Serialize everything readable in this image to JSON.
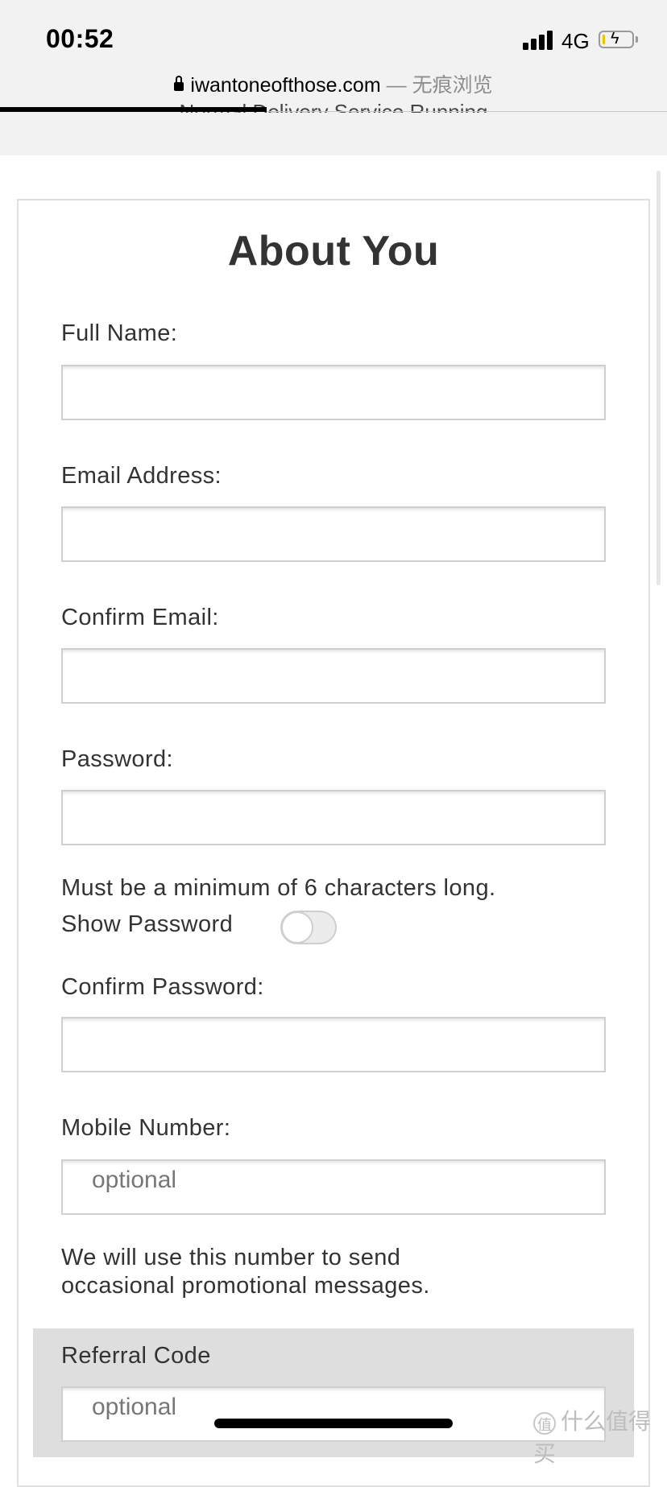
{
  "status_bar": {
    "time": "00:52",
    "network": "4G",
    "battery_level": 0.1,
    "battery_charging": true,
    "signal_bars": 4
  },
  "browser": {
    "domain": "iwantoneofthose.com",
    "mode_suffix": "— 无痕浏览",
    "page_load_progress": 0.4
  },
  "site_banner": {
    "text": "Normal Delivery Service Running"
  },
  "form": {
    "title": "About You",
    "full_name": {
      "label": "Full Name:",
      "value": "",
      "placeholder": ""
    },
    "email": {
      "label": "Email Address:",
      "value": "",
      "placeholder": ""
    },
    "confirm_email": {
      "label": "Confirm Email:",
      "value": "",
      "placeholder": ""
    },
    "password": {
      "label": "Password:",
      "value": "",
      "placeholder": ""
    },
    "password_hint": "Must be a minimum of 6 characters long.",
    "show_password": {
      "label": "Show Password",
      "checked": false
    },
    "confirm_password": {
      "label": "Confirm Password:",
      "value": "",
      "placeholder": ""
    },
    "mobile": {
      "label": "Mobile Number:",
      "value": "",
      "placeholder": "optional"
    },
    "mobile_note_line1": "We will use this number to send",
    "mobile_note_line2": "occasional promotional messages.",
    "referral": {
      "label": "Referral Code",
      "value": "",
      "placeholder": "optional"
    }
  },
  "watermark": {
    "icon": "值",
    "text": "什么值得买"
  }
}
